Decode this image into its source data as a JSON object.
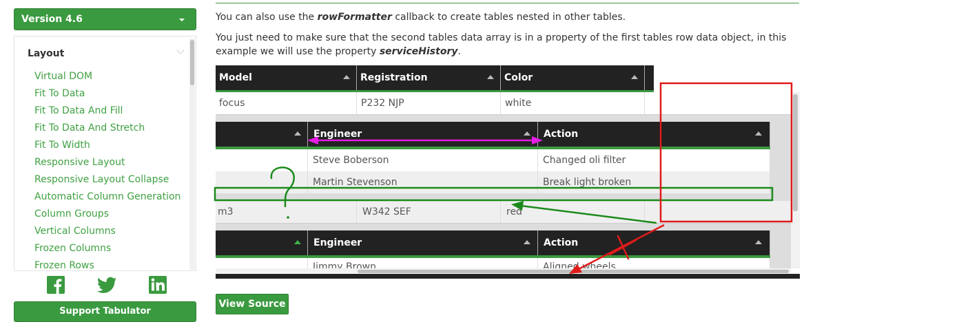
{
  "sidebar": {
    "version_label": "Version 4.6",
    "section_heading": "Layout",
    "items": [
      "Virtual DOM",
      "Fit To Data",
      "Fit To Data And Fill",
      "Fit To Data And Stretch",
      "Fit To Width",
      "Responsive Layout",
      "Responsive Layout Collapse",
      "Automatic Column Generation",
      "Column Groups",
      "Vertical Columns",
      "Frozen Columns",
      "Frozen Rows"
    ],
    "social_icons": [
      "facebook-icon",
      "twitter-icon",
      "linkedin-icon"
    ],
    "support_label": "Support Tabulator",
    "accent_color": "#3a9a3f"
  },
  "content": {
    "para1_before": "You can also use the ",
    "para1_code": "rowFormatter",
    "para1_after": " callback to create tables nested in other tables.",
    "para2_before": "You just need to make sure that the second tables data array is in a property of the first tables row data object, in this example we will use the property ",
    "para2_code": "serviceHistory",
    "para2_after": "."
  },
  "table": {
    "columns": [
      "Model",
      "Registration",
      "Color"
    ],
    "rows": [
      {
        "model": "focus",
        "registration": "P232 NJP",
        "color": "white",
        "service_history": [
          {
            "engineer": "Steve Boberson",
            "action": "Changed oli filter"
          },
          {
            "engineer": "Martin Stevenson",
            "action": "Break light broken"
          }
        ]
      },
      {
        "model": "m3",
        "registration": "W342 SEF",
        "color": "red",
        "service_history": [
          {
            "engineer": "Jimmy Brown",
            "action": "Aligned wheels"
          }
        ]
      }
    ],
    "nested_columns": [
      "Engineer",
      "Action"
    ]
  },
  "view_source_label": "View Source",
  "annotation_colors": {
    "magenta": "#e51de5",
    "green": "#1a8a1a",
    "red": "#e01b1b"
  }
}
